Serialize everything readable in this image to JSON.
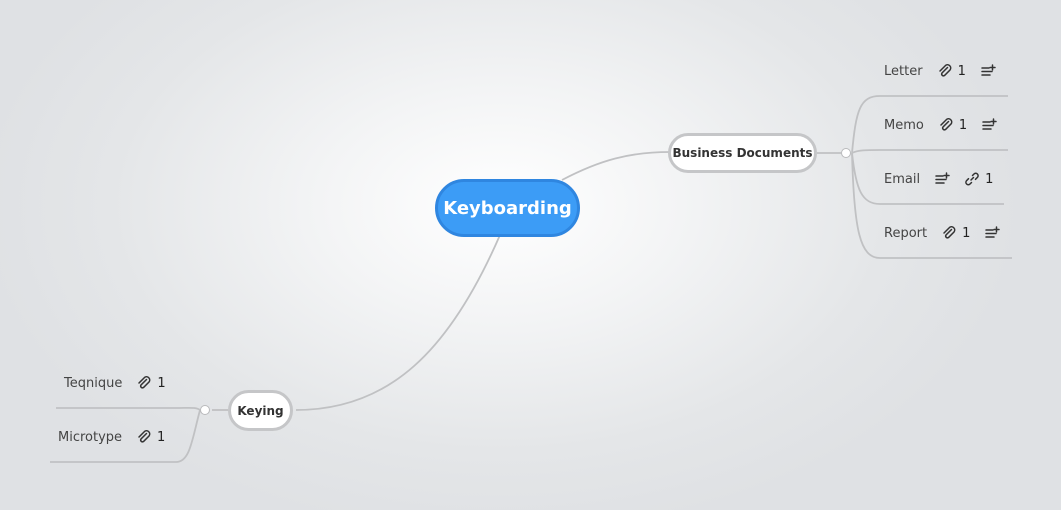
{
  "root": {
    "label": "Keyboarding"
  },
  "branches": {
    "business_documents": {
      "label": "Business Documents",
      "children": [
        {
          "label": "Letter",
          "attachments": "1",
          "has_notes": true
        },
        {
          "label": "Memo",
          "attachments": "1",
          "has_notes": true
        },
        {
          "label": "Email",
          "links": "1",
          "has_notes": true
        },
        {
          "label": "Report",
          "attachments": "1",
          "has_notes": true
        }
      ]
    },
    "keying": {
      "label": "Keying",
      "children": [
        {
          "label": "Teqnique",
          "attachments": "1"
        },
        {
          "label": "Microtype",
          "attachments": "1"
        }
      ]
    }
  },
  "colors": {
    "root_fill": "#3c9cf6",
    "root_border": "#2f86e0",
    "connector": "#c0c1c3",
    "node_border": "#c5c6c8"
  }
}
